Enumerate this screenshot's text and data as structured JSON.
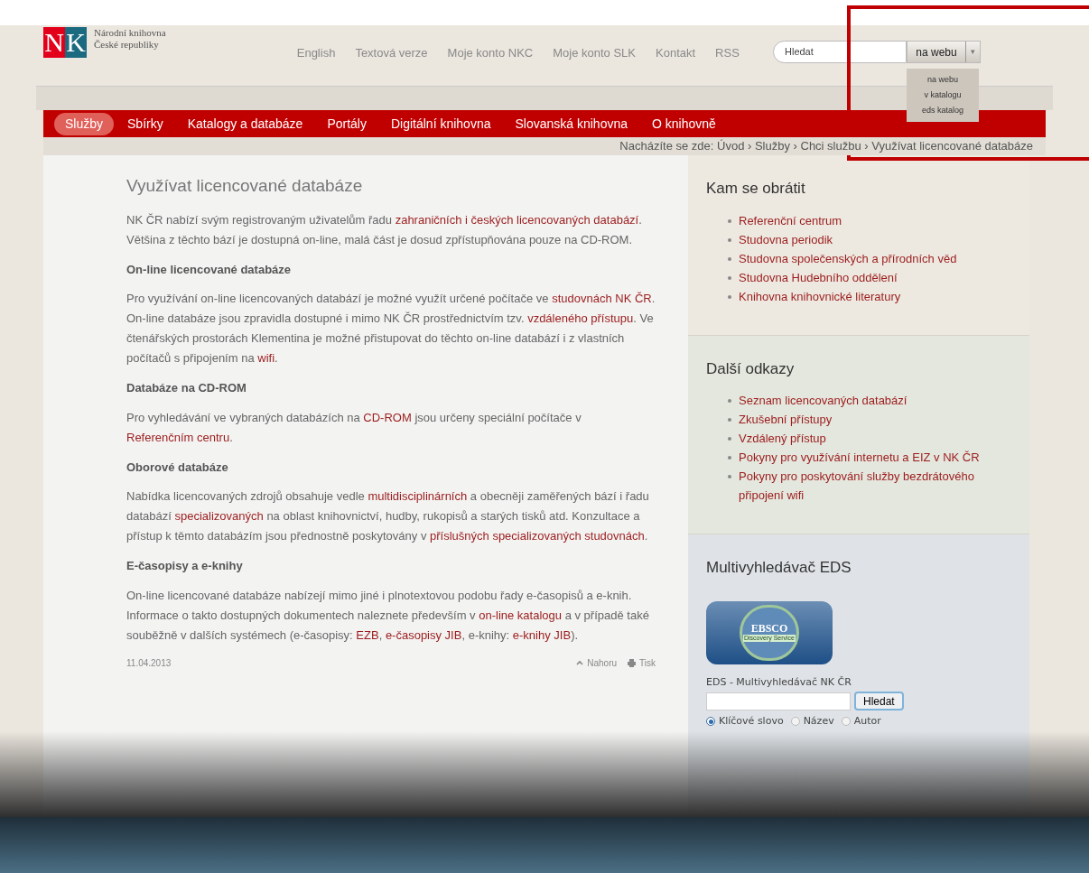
{
  "logo": {
    "mark_left": "N",
    "mark_right": "K",
    "line_1": "Národní knihovna",
    "line_2": "České republiky"
  },
  "top_links": [
    "English",
    "Textová verze",
    "Moje konto NKC",
    "Moje konto SLK",
    "Kontakt",
    "RSS"
  ],
  "search": {
    "placeholder": "Hledat",
    "scope": "na webu",
    "scope_arrow": "▾",
    "scope_options": [
      "na webu",
      "v katalogu",
      "eds katalog"
    ]
  },
  "nav": [
    {
      "label": "Služby",
      "selected": true
    },
    {
      "label": "Sbírky",
      "selected": false
    },
    {
      "label": "Katalogy a databáze",
      "selected": false
    },
    {
      "label": "Portály",
      "selected": false
    },
    {
      "label": "Digitální knihovna",
      "selected": false
    },
    {
      "label": "Slovanská knihovna",
      "selected": false
    },
    {
      "label": "O knihovně",
      "selected": false
    }
  ],
  "breadcrumb": "Nacházíte se zde: Úvod › Služby › Chci službu › Využívat licencované databáze",
  "article": {
    "title": "Využívat licencované databáze",
    "blocks": [
      {
        "kind": "paragraph",
        "segments": [
          {
            "kind": "text",
            "text": "NK ČR nabízí svým registrovaným uživatelům řadu "
          },
          {
            "kind": "link",
            "text": "zahraničních i českých licencovaných"
          },
          {
            "kind": "link",
            "text": "databází"
          },
          {
            "kind": "text",
            "text": ". Většina z těchto bází je dostupná on-line, malá část je dosud zpřístupňována pouze na CD-ROM."
          }
        ]
      },
      {
        "kind": "heading",
        "text": "On-line licencované databáze"
      },
      {
        "kind": "paragraph",
        "segments": [
          {
            "kind": "text",
            "text": "Pro využívání on-line licencovaných databází je možné využít určené počítače ve "
          },
          {
            "kind": "link",
            "text": "studovnách"
          },
          {
            "kind": "link",
            "text": "NK ČR"
          },
          {
            "kind": "text",
            "text": ". On-line databáze jsou zpravidla dostupné i mimo NK ČR prostřednictvím tzv. "
          },
          {
            "kind": "link",
            "text": "vzdáleného přístupu"
          },
          {
            "kind": "text",
            "text": ". Ve čtenářských prostorách Klementina je možné přistupovat do těchto on-line databází i z vlastních počítačů s připojením na "
          },
          {
            "kind": "link",
            "text": "wifi"
          },
          {
            "kind": "text",
            "text": "."
          }
        ]
      },
      {
        "kind": "heading",
        "text": "Databáze na CD-ROM"
      },
      {
        "kind": "paragraph",
        "segments": [
          {
            "kind": "text",
            "text": "Pro vyhledávání ve vybraných databázích na "
          },
          {
            "kind": "link",
            "text": "CD-ROM"
          },
          {
            "kind": "text",
            "text": " jsou určeny speciální počítače v "
          },
          {
            "kind": "link",
            "text": "Referenčním centru"
          },
          {
            "kind": "text",
            "text": "."
          }
        ]
      },
      {
        "kind": "heading",
        "text": "Oborové databáze"
      },
      {
        "kind": "paragraph",
        "segments": [
          {
            "kind": "text",
            "text": "Nabídka licencovaných zdrojů obsahuje vedle "
          },
          {
            "kind": "link",
            "text": "multidisciplinárních"
          },
          {
            "kind": "text",
            "text": " a obecněji zaměřených bází i řadu databází "
          },
          {
            "kind": "link",
            "text": "specializovaných"
          },
          {
            "kind": "text",
            "text": " na oblast knihovnictví, hudby, rukopisů a starých tisků atd. Konzultace a přístup k těmto databázím jsou přednostně poskytovány v "
          },
          {
            "kind": "link",
            "text": "příslušných"
          },
          {
            "kind": "link",
            "text": "specializovaných studovnách"
          },
          {
            "kind": "text",
            "text": "."
          }
        ]
      },
      {
        "kind": "heading",
        "text": "E-časopisy a e-knihy"
      },
      {
        "kind": "paragraph",
        "segments": [
          {
            "kind": "text",
            "text": "On-line licencované databáze nabízejí mimo jiné i plnotextovou podobu řady e-časopisů a e-knih. Informace o takto dostupných dokumentech naleznete především v "
          },
          {
            "kind": "link",
            "text": "on-line katalogu"
          },
          {
            "kind": "text",
            "text": " a v případě také souběžně v dalších systémech (e-časopisy: "
          },
          {
            "kind": "link",
            "text": "EZB"
          },
          {
            "kind": "text",
            "text": ", "
          },
          {
            "kind": "link",
            "text": "e-časopisy JIB"
          },
          {
            "kind": "text",
            "text": ", e-knihy: "
          },
          {
            "kind": "link",
            "text": "e-knihy"
          },
          {
            "kind": "link",
            "text": "JIB"
          },
          {
            "kind": "text",
            "text": ")."
          }
        ]
      }
    ],
    "date": "11.04.2013",
    "top_link": "Nahoru",
    "print_link": "Tisk"
  },
  "sidebar": [
    {
      "kind": "links",
      "title": "Kam se obrátit",
      "items": [
        "Referenční centrum",
        "Studovna periodik",
        "Studovna společenských a přírodních věd",
        "Studovna Hudebního oddělení",
        "Knihovna knihovnické literatury"
      ]
    },
    {
      "kind": "links",
      "title": "Další odkazy",
      "items": [
        "Seznam licencovaných databází",
        "Zkušební přístupy",
        "Vzdálený přístup",
        "Pokyny pro využívání internetu a EIZ v NK ČR",
        "Pokyny pro poskytování služby bezdrátového připojení wifi"
      ]
    },
    {
      "kind": "eds",
      "title": "Multivyhledávač EDS",
      "logo_text": "EBSCO",
      "logo_subtext": "Discovery Service",
      "label": "EDS - Multivyhledávač NK ČR",
      "button": "Hledat",
      "options": [
        {
          "label": "Klíčové slovo",
          "selected": true
        },
        {
          "label": "Název",
          "selected": false
        },
        {
          "label": "Autor",
          "selected": false
        }
      ]
    }
  ]
}
